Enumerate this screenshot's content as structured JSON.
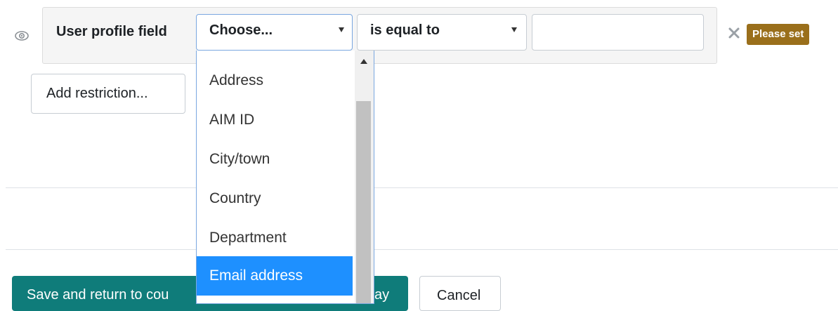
{
  "restriction": {
    "field_label": "User profile field",
    "field_select": {
      "value": "Choose...",
      "options": [
        "Address",
        "AIM ID",
        "City/town",
        "Country",
        "Department",
        "Email address"
      ],
      "selected_option": "Email address"
    },
    "operator_select": {
      "value": "is equal to"
    },
    "value_input": {
      "value": ""
    },
    "status_badge": "Please set"
  },
  "actions": {
    "add_restriction": "Add restriction...",
    "save_and_return": "Save and return to cou",
    "save_and_display_tail": "ay",
    "cancel": "Cancel"
  },
  "icons": {
    "visibility": "eye-icon",
    "delete": "close-icon"
  },
  "colors": {
    "selected": "#1e90ff",
    "primary": "#0f7c7a",
    "badge": "#9a6f1b"
  }
}
